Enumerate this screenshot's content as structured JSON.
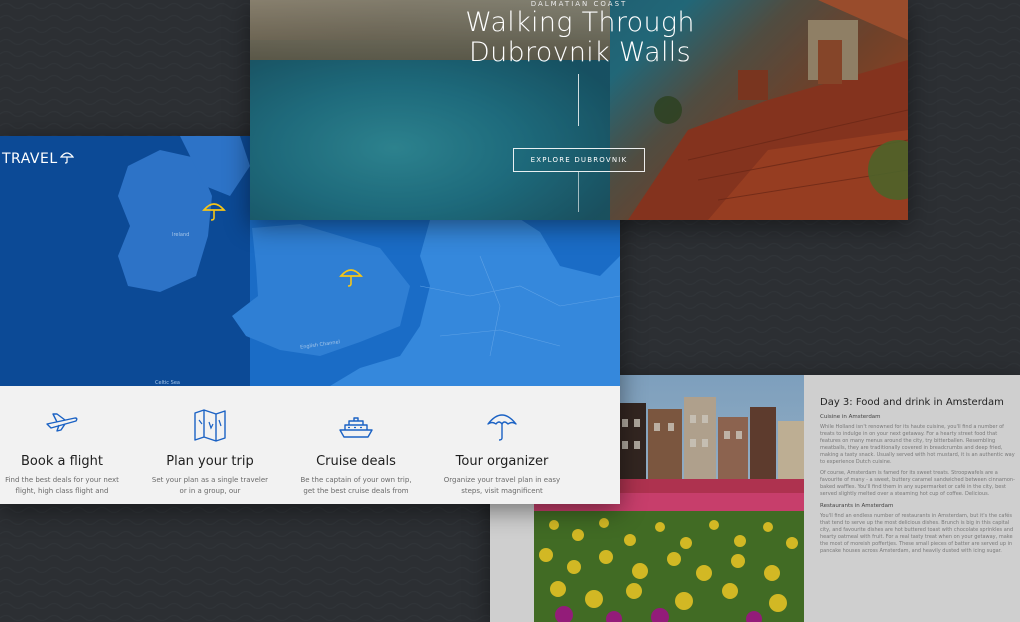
{
  "hero": {
    "kicker": "DALMATIAN COAST",
    "title_line1": "Walking Through",
    "title_line2": "Dubrovnik Walls",
    "cta_label": "EXPLORE DUBROVNIK"
  },
  "travel": {
    "logo": "TRAVEL",
    "map_labels": {
      "ireland": "Ireland",
      "english_channel": "English Channel",
      "celtic_sea": "Celtic Sea"
    },
    "features": [
      {
        "title": "Book a flight",
        "description": "Find the best deals for your next flight, high class flight and",
        "icon": "airplane-icon"
      },
      {
        "title": "Plan your trip",
        "description": "Set your plan as a single traveler or in a group, our",
        "icon": "map-icon"
      },
      {
        "title": "Cruise deals",
        "description": "Be the captain of your own trip, get the best cruise deals from",
        "icon": "ship-icon"
      },
      {
        "title": "Tour organizer",
        "description": "Organize your travel plan in easy steps, visit magnificent",
        "icon": "umbrella-icon"
      }
    ],
    "accent_color": "#1b62c4",
    "marker_color": "#f5c518"
  },
  "amsterdam": {
    "heading": "Day  3: Food and drink in Amsterdam",
    "subheading1": "Cuisine in Amsterdam",
    "paragraph1": "While Holland isn't renowned for its haute cuisine, you'll find a number of treats to indulge in on your next getaway. For a hearty street food that features on many menus around the city, try bitterballen. Resembling meatballs, they are traditionally covered in breadcrumbs and deep fried, making a tasty snack. Usually served with hot mustard, it is an authentic way to experience Dutch cuisine.",
    "paragraph2": "Of course, Amsterdam is famed for its sweet treats. Stroopwafels are a favourite of many - a sweet, buttery caramel sandwiched between cinnamon-baked waffles. You'll find them in any supermarket or café in the city, best served slightly melted over a steaming hot cup of coffee. Delicious.",
    "subheading2": "Restaurants in Amsterdam",
    "paragraph3": "You'll find an endless number of restaurants in Amsterdam, but it's the cafés that tend to serve up the most delicious dishes. Brunch is big in this capital city, and favourite dishes are hot buttered toast with chocolate sprinkles and hearty oatmeal with fruit. For a real tasty treat when on your getaway, make the most of moreish poffertjes. These small pieces of batter are served up in pancake houses across Amsterdam, and heavily dusted with icing sugar."
  }
}
